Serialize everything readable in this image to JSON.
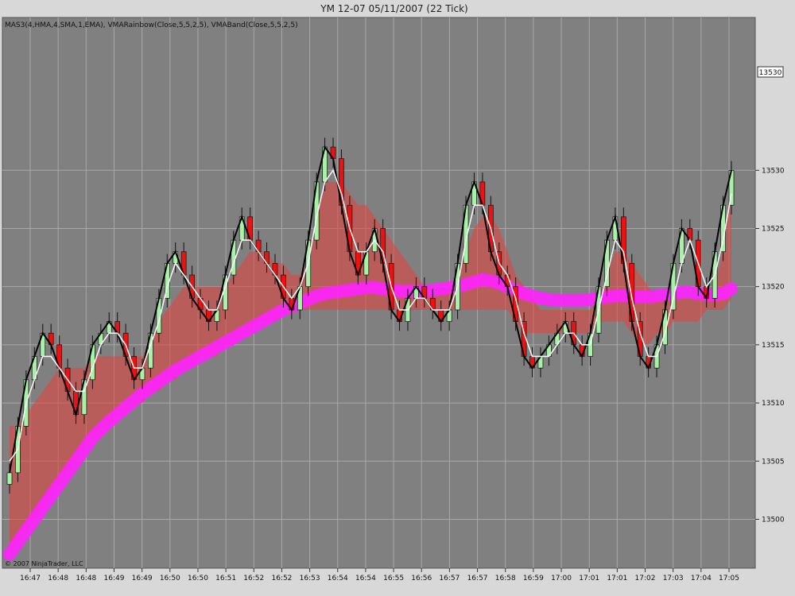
{
  "window": {
    "title": "YM 12-07  05/11/2007  (22 Tick)",
    "indicator_legend": "MAS3(4,HMA,4,SMA,1,EMA), VMARainbow(Close,5,5,2,5), VMABand(Close,5,5,2,5)",
    "copyright": "© 2007 NinjaTrader, LLC",
    "last_price_label": "13530"
  },
  "colors": {
    "background": "#808080",
    "frame": "#d8d8d8",
    "grid": "#a8a8a8",
    "up_candle": "#a7f2a7",
    "down_candle": "#ee1111",
    "doji_candle": "#e8c27a",
    "band_fill": "#e8403a",
    "vma_line": "#ff22ff",
    "fast_ma": "#000000",
    "slow_ma": "#ffffff"
  },
  "chart_data": {
    "type": "line",
    "subtype": "candlestick with moving averages and volatility band",
    "title": "YM 12-07  05/11/2007  (22 Tick)",
    "ylim": [
      13496,
      13543
    ],
    "y_ticks": [
      "13500",
      "13505",
      "13510",
      "13515",
      "13520",
      "13525",
      "13530"
    ],
    "x_ticks": [
      "16:47",
      "16:48",
      "16:48",
      "16:49",
      "16:49",
      "16:50",
      "16:50",
      "16:51",
      "16:52",
      "16:52",
      "16:53",
      "16:54",
      "16:54",
      "16:55",
      "16:56",
      "16:57",
      "16:57",
      "16:58",
      "16:59",
      "17:00",
      "17:01",
      "17:01",
      "17:02",
      "17:03",
      "17:04",
      "17:05"
    ],
    "grid": true,
    "price_axis_position": "right",
    "series": [
      {
        "name": "MAS3 fast (HMA)",
        "values": [
          13504,
          13508,
          13512,
          13514,
          13516,
          13515,
          13513,
          13511,
          13509,
          13512,
          13515,
          13516,
          13517,
          13516,
          13514,
          13512,
          13513,
          13516,
          13519,
          13522,
          13523,
          13521,
          13519,
          13518,
          13517,
          13518,
          13521,
          13524,
          13526,
          13524,
          13523,
          13522,
          13521,
          13519,
          13518,
          13520,
          13524,
          13529,
          13532,
          13531,
          13527,
          13523,
          13521,
          13523,
          13525,
          13522,
          13518,
          13517,
          13519,
          13520,
          13519,
          13518,
          13517,
          13518,
          13522,
          13527,
          13529,
          13527,
          13523,
          13521,
          13520,
          13517,
          13514,
          13513,
          13514,
          13515,
          13516,
          13517,
          13515,
          13514,
          13516,
          13520,
          13524,
          13526,
          13522,
          13517,
          13514,
          13513,
          13515,
          13518,
          13522,
          13525,
          13524,
          13520,
          13519,
          13523,
          13527,
          13530
        ]
      },
      {
        "name": "MAS3 slow (SMA)",
        "values": [
          13505,
          13506,
          13510,
          13512,
          13514,
          13514,
          13513,
          13512,
          13511,
          13511,
          13513,
          13515,
          13516,
          13516,
          13515,
          13513,
          13513,
          13515,
          13517,
          13520,
          13522,
          13521,
          13520,
          13519,
          13518,
          13518,
          13520,
          13522,
          13524,
          13524,
          13523,
          13522,
          13521,
          13520,
          13519,
          13520,
          13522,
          13526,
          13529,
          13530,
          13528,
          13525,
          13523,
          13523,
          13524,
          13523,
          13520,
          13518,
          13518,
          13519,
          13519,
          13518,
          13518,
          13518,
          13520,
          13524,
          13527,
          13527,
          13525,
          13522,
          13521,
          13519,
          13516,
          13514,
          13514,
          13514,
          13515,
          13516,
          13516,
          13515,
          13515,
          13518,
          13521,
          13524,
          13523,
          13519,
          13516,
          13514,
          13514,
          13516,
          13519,
          13522,
          13524,
          13522,
          13520,
          13521,
          13524,
          13528
        ]
      },
      {
        "name": "VMA",
        "values": [
          13497,
          13498,
          13499,
          13500,
          13501,
          13502,
          13503,
          13504,
          13505,
          13506,
          13507,
          13507.7,
          13508.4,
          13509,
          13509.6,
          13510.2,
          13510.8,
          13511.3,
          13511.8,
          13512.3,
          13512.8,
          13513.2,
          13513.6,
          13514,
          13514.4,
          13514.8,
          13515.2,
          13515.6,
          13516,
          13516.4,
          13516.8,
          13517.2,
          13517.6,
          13518,
          13518.3,
          13518.6,
          13518.9,
          13519.2,
          13519.4,
          13519.5,
          13519.6,
          13519.7,
          13519.8,
          13519.9,
          13519.9,
          13519.8,
          13519.7,
          13519.6,
          13519.6,
          13519.6,
          13519.6,
          13519.7,
          13519.8,
          13519.9,
          13520,
          13520.2,
          13520.4,
          13520.6,
          13520.5,
          13520.3,
          13520,
          13519.7,
          13519.4,
          13519.2,
          13519,
          13518.9,
          13518.8,
          13518.8,
          13518.8,
          13518.8,
          13518.9,
          13519,
          13519.1,
          13519.2,
          13519.2,
          13519.2,
          13519.1,
          13519.1,
          13519.2,
          13519.3,
          13519.4,
          13519.5,
          13519.5,
          13519.4,
          13519.3,
          13519.3,
          13519.4,
          13519.8
        ]
      },
      {
        "name": "VMA band upper",
        "values": [
          13508,
          13508,
          13509,
          13510,
          13511,
          13512,
          13513,
          13513,
          13513,
          13513,
          13514,
          13514,
          13514,
          13514,
          13514,
          13514,
          13514,
          13515,
          13517,
          13518,
          13519,
          13520,
          13520,
          13520,
          13520,
          13520,
          13520,
          13521,
          13522,
          13523,
          13523,
          13523,
          13522,
          13522,
          13521,
          13521,
          13522,
          13526,
          13529,
          13529,
          13529,
          13528,
          13527,
          13527,
          13526,
          13525,
          13524,
          13523,
          13522,
          13521,
          13520,
          13520,
          13520,
          13520,
          13521,
          13523,
          13525,
          13526,
          13526,
          13525,
          13523,
          13521,
          13520,
          13519,
          13518,
          13518,
          13518,
          13518,
          13518,
          13518,
          13518,
          13519,
          13521,
          13523,
          13523,
          13522,
          13521,
          13520,
          13519,
          13519,
          13519,
          13519,
          13519,
          13519,
          13519,
          13520,
          13523,
          13528
        ]
      },
      {
        "name": "VMA band lower",
        "values": [
          13497,
          13498,
          13499,
          13500,
          13501,
          13502,
          13503,
          13504,
          13505,
          13506,
          13507,
          13507,
          13508,
          13509,
          13509,
          13510,
          13510,
          13511,
          13511,
          13512,
          13512,
          13513,
          13513,
          13514,
          13514,
          13514,
          13515,
          13515,
          13516,
          13516,
          13517,
          13517,
          13517,
          13518,
          13518,
          13518,
          13518,
          13518,
          13518,
          13518,
          13518,
          13518,
          13518,
          13518,
          13518,
          13518,
          13518,
          13518,
          13518,
          13518,
          13518,
          13518,
          13518,
          13518,
          13518,
          13518,
          13518,
          13518,
          13518,
          13518,
          13518,
          13517,
          13516,
          13516,
          13516,
          13516,
          13516,
          13516,
          13516,
          13516,
          13516,
          13517,
          13517,
          13517,
          13517,
          13516,
          13515,
          13515,
          13516,
          13516,
          13517,
          13517,
          13517,
          13517,
          13518,
          13518,
          13518,
          13519
        ]
      }
    ],
    "candles_close": [
      13504,
      13508,
      13512,
      13514,
      13516,
      13515,
      13513,
      13511,
      13509,
      13512,
      13515,
      13516,
      13517,
      13516,
      13514,
      13512,
      13513,
      13516,
      13519,
      13522,
      13523,
      13521,
      13519,
      13518,
      13517,
      13518,
      13521,
      13524,
      13526,
      13524,
      13523,
      13522,
      13521,
      13519,
      13518,
      13520,
      13524,
      13529,
      13532,
      13531,
      13527,
      13523,
      13521,
      13523,
      13525,
      13522,
      13518,
      13517,
      13519,
      13520,
      13519,
      13518,
      13517,
      13518,
      13522,
      13527,
      13529,
      13527,
      13523,
      13521,
      13520,
      13517,
      13514,
      13513,
      13514,
      13515,
      13516,
      13517,
      13515,
      13514,
      13516,
      13520,
      13524,
      13526,
      13522,
      13517,
      13514,
      13513,
      13515,
      13518,
      13522,
      13525,
      13524,
      13520,
      13519,
      13523,
      13527,
      13530
    ]
  }
}
